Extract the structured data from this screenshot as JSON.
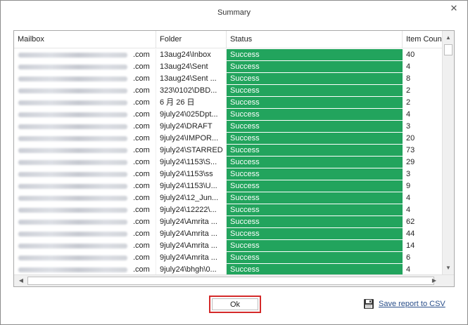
{
  "dialog": {
    "title": "Summary",
    "close_glyph": "✕"
  },
  "grid": {
    "columns": {
      "mailbox": "Mailbox",
      "folder": "Folder",
      "status": "Status",
      "count": "Item Count"
    },
    "rows": [
      {
        "mailbox_domain": ".com",
        "folder": "13aug24\\Inbox",
        "status": "Success",
        "count": "40"
      },
      {
        "mailbox_domain": ".com",
        "folder": "13aug24\\Sent",
        "status": "Success",
        "count": "4"
      },
      {
        "mailbox_domain": ".com",
        "folder": "13aug24\\Sent ...",
        "status": "Success",
        "count": "8"
      },
      {
        "mailbox_domain": ".com",
        "folder": "323\\0102\\DBD...",
        "status": "Success",
        "count": "2"
      },
      {
        "mailbox_domain": ".com",
        "folder": "6 月 26 日",
        "status": "Success",
        "count": "2"
      },
      {
        "mailbox_domain": ".com",
        "folder": "9july24\\025Dpt...",
        "status": "Success",
        "count": "4"
      },
      {
        "mailbox_domain": ".com",
        "folder": "9july24\\DRAFT",
        "status": "Success",
        "count": "3"
      },
      {
        "mailbox_domain": ".com",
        "folder": "9july24\\IMPOR...",
        "status": "Success",
        "count": "20"
      },
      {
        "mailbox_domain": ".com",
        "folder": "9july24\\STARRED",
        "status": "Success",
        "count": "73"
      },
      {
        "mailbox_domain": ".com",
        "folder": "9july24\\1153\\S...",
        "status": "Success",
        "count": "29"
      },
      {
        "mailbox_domain": ".com",
        "folder": "9july24\\1153\\ss",
        "status": "Success",
        "count": "3"
      },
      {
        "mailbox_domain": ".com",
        "folder": "9july24\\1153\\U...",
        "status": "Success",
        "count": "9"
      },
      {
        "mailbox_domain": ".com",
        "folder": "9july24\\12_Jun...",
        "status": "Success",
        "count": "4"
      },
      {
        "mailbox_domain": ".com",
        "folder": "9july24\\12222\\...",
        "status": "Success",
        "count": "4"
      },
      {
        "mailbox_domain": ".com",
        "folder": "9july24\\Amrita ...",
        "status": "Success",
        "count": "62"
      },
      {
        "mailbox_domain": ".com",
        "folder": "9july24\\Amrita ...",
        "status": "Success",
        "count": "44"
      },
      {
        "mailbox_domain": ".com",
        "folder": "9july24\\Amrita ...",
        "status": "Success",
        "count": "14"
      },
      {
        "mailbox_domain": ".com",
        "folder": "9july24\\Amrita ...",
        "status": "Success",
        "count": "6"
      },
      {
        "mailbox_domain": ".com",
        "folder": "9july24\\bhgh\\0...",
        "status": "Success",
        "count": "4"
      }
    ],
    "scroll": {
      "up_glyph": "▲",
      "down_glyph": "▼",
      "left_glyph": "◀",
      "right_glyph": "▶"
    }
  },
  "footer": {
    "ok_label": "Ok",
    "save_label": "Save report to CSV",
    "save_icon": "save-disk-icon"
  },
  "colors": {
    "success": "#22a45d",
    "highlight_border": "#d42a2a",
    "link": "#2a4f8a"
  }
}
